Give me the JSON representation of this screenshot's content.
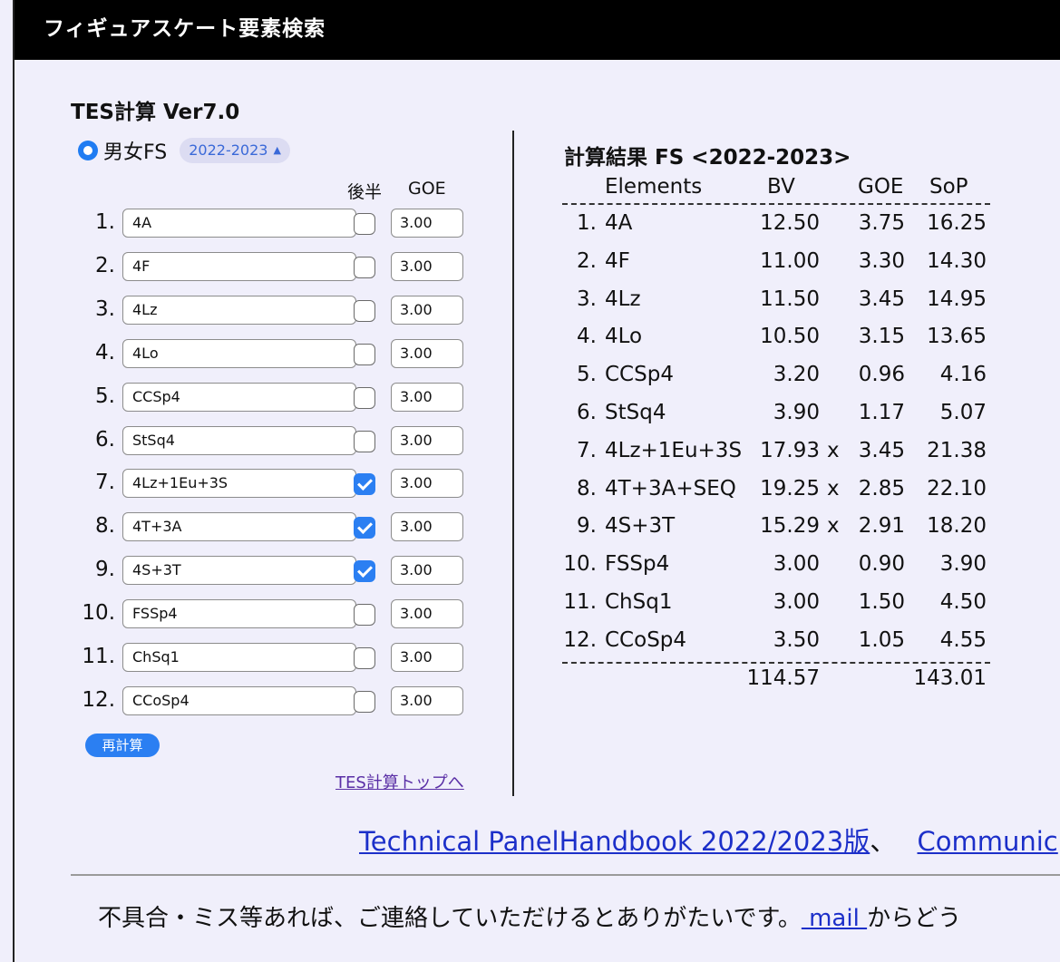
{
  "header": {
    "title": "フィギュアスケート要素検索"
  },
  "calc": {
    "title": "TES計算 Ver7.0",
    "radio_label": "男女FS",
    "season": "2022-2023",
    "col_second_half": "後半",
    "col_goe": "GOE",
    "rows": [
      {
        "num": "1.",
        "element": "4A",
        "second_half": false,
        "goe": "3.00"
      },
      {
        "num": "2.",
        "element": "4F",
        "second_half": false,
        "goe": "3.00"
      },
      {
        "num": "3.",
        "element": "4Lz",
        "second_half": false,
        "goe": "3.00"
      },
      {
        "num": "4.",
        "element": "4Lo",
        "second_half": false,
        "goe": "3.00"
      },
      {
        "num": "5.",
        "element": "CCSp4",
        "second_half": false,
        "goe": "3.00"
      },
      {
        "num": "6.",
        "element": "StSq4",
        "second_half": false,
        "goe": "3.00"
      },
      {
        "num": "7.",
        "element": "4Lz+1Eu+3S",
        "second_half": true,
        "goe": "3.00"
      },
      {
        "num": "8.",
        "element": "4T+3A",
        "second_half": true,
        "goe": "3.00"
      },
      {
        "num": "9.",
        "element": "4S+3T",
        "second_half": true,
        "goe": "3.00"
      },
      {
        "num": "10.",
        "element": "FSSp4",
        "second_half": false,
        "goe": "3.00"
      },
      {
        "num": "11.",
        "element": "ChSq1",
        "second_half": false,
        "goe": "3.00"
      },
      {
        "num": "12.",
        "element": "CCoSp4",
        "second_half": false,
        "goe": "3.00"
      }
    ],
    "recalc_label": "再計算",
    "top_link": "TES計算トップへ"
  },
  "result": {
    "title": "計算結果 FS <2022-2023>",
    "headers": {
      "elements": "Elements",
      "bv": "BV",
      "goe": "GOE",
      "sop": "SoP"
    },
    "rows": [
      {
        "num": "1.",
        "element": "4A",
        "bv": "12.50",
        "mark": "",
        "goe": "3.75",
        "sop": "16.25"
      },
      {
        "num": "2.",
        "element": "4F",
        "bv": "11.00",
        "mark": "",
        "goe": "3.30",
        "sop": "14.30"
      },
      {
        "num": "3.",
        "element": "4Lz",
        "bv": "11.50",
        "mark": "",
        "goe": "3.45",
        "sop": "14.95"
      },
      {
        "num": "4.",
        "element": "4Lo",
        "bv": "10.50",
        "mark": "",
        "goe": "3.15",
        "sop": "13.65"
      },
      {
        "num": "5.",
        "element": "CCSp4",
        "bv": "3.20",
        "mark": "",
        "goe": "0.96",
        "sop": "4.16"
      },
      {
        "num": "6.",
        "element": "StSq4",
        "bv": "3.90",
        "mark": "",
        "goe": "1.17",
        "sop": "5.07"
      },
      {
        "num": "7.",
        "element": "4Lz+1Eu+3S",
        "bv": "17.93",
        "mark": "x",
        "goe": "3.45",
        "sop": "21.38"
      },
      {
        "num": "8.",
        "element": "4T+3A+SEQ",
        "bv": "19.25",
        "mark": "x",
        "goe": "2.85",
        "sop": "22.10"
      },
      {
        "num": "9.",
        "element": "4S+3T",
        "bv": "15.29",
        "mark": "x",
        "goe": "2.91",
        "sop": "18.20"
      },
      {
        "num": "10.",
        "element": "FSSp4",
        "bv": "3.00",
        "mark": "",
        "goe": "0.90",
        "sop": "3.90"
      },
      {
        "num": "11.",
        "element": "ChSq1",
        "bv": "3.00",
        "mark": "",
        "goe": "1.50",
        "sop": "4.50"
      },
      {
        "num": "12.",
        "element": "CCoSp4",
        "bv": "3.50",
        "mark": "",
        "goe": "1.05",
        "sop": "4.55"
      }
    ],
    "total_bv": "114.57",
    "total_sop": "143.01"
  },
  "links": {
    "handbook": "Technical PanelHandbook 2022/2023版",
    "separator": "、",
    "communication": "Communic"
  },
  "footer": {
    "text": "不具合・ミス等あれば、ご連絡していただけるとありがたいです。",
    "mail_link": " mail ",
    "after": "からどう"
  },
  "colors": {
    "accent": "#2b7ff2",
    "background": "#f0effb",
    "header": "#000000",
    "link": "#1c2fc9"
  }
}
